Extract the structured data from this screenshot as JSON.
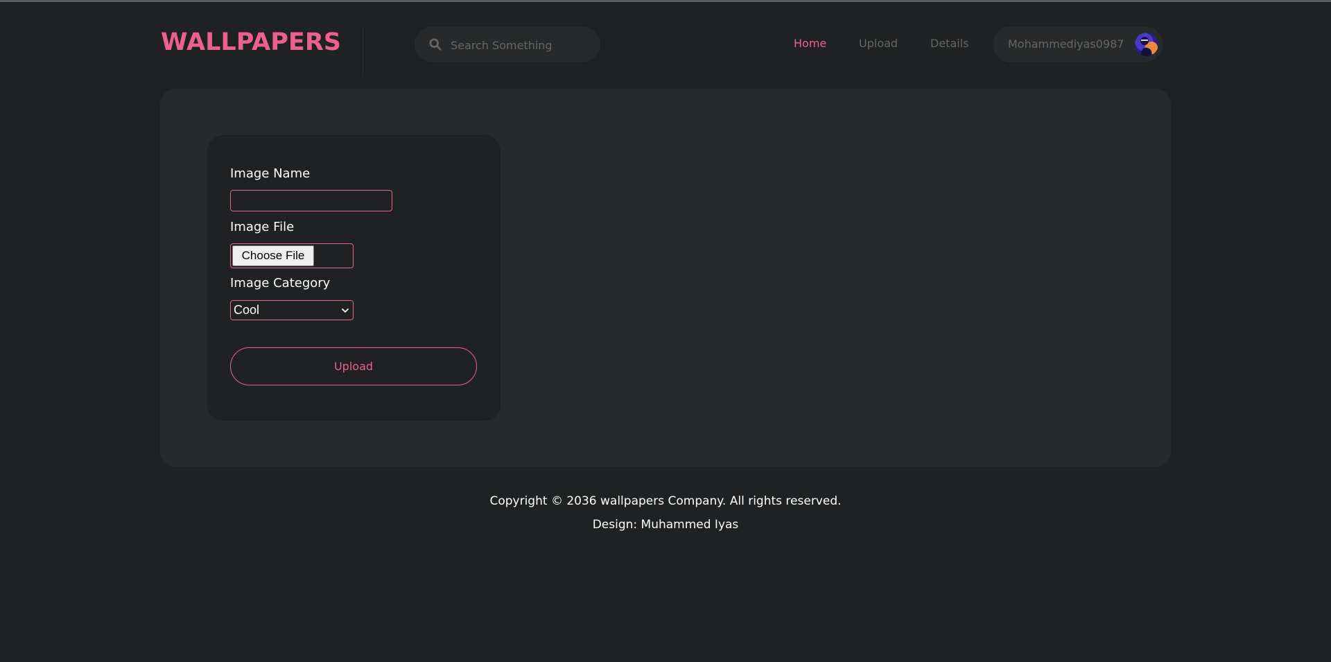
{
  "header": {
    "logo": "WALLPAPERS",
    "search": {
      "placeholder": "Search Something",
      "value": ""
    },
    "nav": [
      {
        "label": "Home",
        "active": true
      },
      {
        "label": "Upload",
        "active": false
      },
      {
        "label": "Details",
        "active": false
      }
    ],
    "profile": {
      "username": "Mohammediyas0987"
    }
  },
  "form": {
    "image_name_label": "Image Name",
    "image_name_value": "",
    "image_file_label": "Image File",
    "choose_file_label": "Choose File",
    "image_category_label": "Image Category",
    "category_selected": "Cool",
    "upload_label": "Upload"
  },
  "footer": {
    "copyright": "Copyright © 2036 wallpapers Company. All rights reserved.",
    "design": "Design: Muhammed Iyas"
  },
  "colors": {
    "accent": "#ec6090",
    "background": "#1f2122",
    "panel": "#27292a",
    "muted_text": "#666666"
  },
  "icons": {
    "search": "search-icon",
    "chevron": "chevron-down-icon",
    "avatar": "avatar"
  }
}
